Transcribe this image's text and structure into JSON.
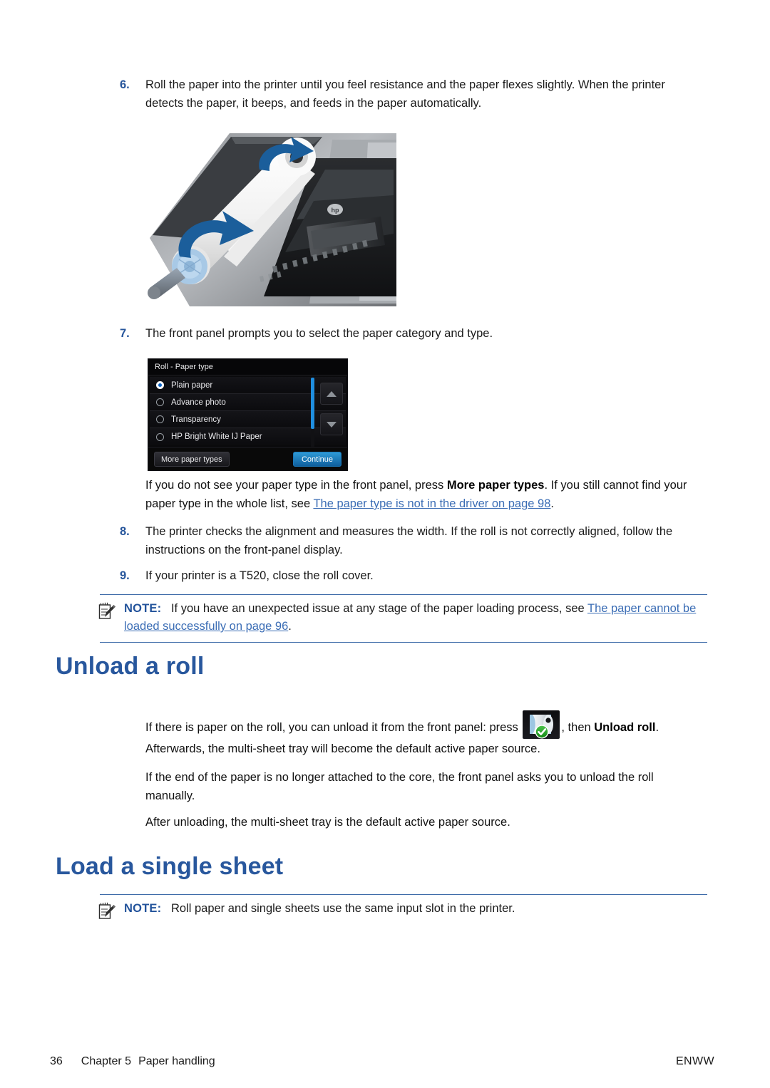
{
  "steps": [
    {
      "num": "6.",
      "text": "Roll the paper into the printer until you feel resistance and the paper flexes slightly. When the printer detects the paper, it beeps, and feeds in the paper automatically."
    },
    {
      "num": "7.",
      "text": "The front panel prompts you to select the paper category and type."
    },
    {
      "num": "8.",
      "text": "The printer checks the alignment and measures the width. If the roll is not correctly aligned, follow the instructions on the front-panel display."
    },
    {
      "num": "9.",
      "text": "If your printer is a T520, close the roll cover."
    }
  ],
  "front_panel": {
    "title": "Roll - Paper type",
    "options": [
      {
        "label": "Plain paper",
        "selected": true
      },
      {
        "label": "Advance photo",
        "selected": false
      },
      {
        "label": "Transparency",
        "selected": false
      },
      {
        "label": "HP Bright White IJ Paper",
        "selected": false
      }
    ],
    "more_button": "More paper types",
    "continue_button": "Continue"
  },
  "paper_type_paragraph": {
    "part1": "If you do not see your paper type in the front panel, press ",
    "bold1": "More paper types",
    "part2": ". If you still cannot find your paper type in the whole list, see ",
    "link1": "The paper type is not in the driver on page 98",
    "part3": "."
  },
  "note_paper_loading": {
    "label": "NOTE:",
    "part1": "If you have an unexpected issue at any stage of the paper loading process, see ",
    "link1": "The paper cannot be loaded successfully on page 96",
    "part2": "."
  },
  "unload_section": {
    "heading": "Unload a roll",
    "para1_part1": "If there is paper on the roll, you can unload it from the front panel: press ",
    "para1_part2": ", then ",
    "para1_bold": "Unload roll",
    "para1_part3": ".",
    "para2": "Afterwards, the multi-sheet tray will become the default active paper source.",
    "para3": "If the end of the paper is no longer attached to the core, the front panel asks you to unload the roll manually.",
    "para4": "After unloading, the multi-sheet tray is the default active paper source."
  },
  "load_section": {
    "heading": "Load a single sheet",
    "note_label": "NOTE:",
    "note_text": "Roll paper and single sheets use the same input slot in the printer."
  },
  "footer": {
    "page_number": "36",
    "chapter": "Chapter 5",
    "chapter_title": "Paper handling",
    "right": "ENWW"
  },
  "colors": {
    "heading_blue": "#28579d",
    "link_blue": "#3b6db5",
    "number_blue": "#26559b",
    "note_rule": "#3c6aa8",
    "panel_accent": "#1f8fe0"
  },
  "icons": {
    "note": "note-pencil-icon",
    "roll": "paper-roll-status-icon"
  }
}
